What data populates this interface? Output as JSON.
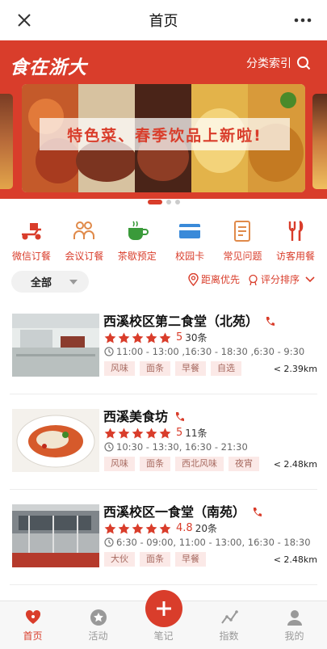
{
  "topbar": {
    "title": "首页"
  },
  "banner": {
    "logo_text": "食在浙大",
    "category_index_label": "分类索引",
    "slide_caption": "特色菜、春季饮品上新啦!",
    "slide_count": 3,
    "active_slide": 1
  },
  "quick_links": [
    {
      "label": "微信订餐",
      "icon": "delivery-scooter-icon"
    },
    {
      "label": "会议订餐",
      "icon": "group-people-icon"
    },
    {
      "label": "茶歇预定",
      "icon": "tea-cup-icon"
    },
    {
      "label": "校园卡",
      "icon": "campus-card-icon"
    },
    {
      "label": "常见问题",
      "icon": "faq-document-icon"
    },
    {
      "label": "访客用餐",
      "icon": "fork-knife-icon"
    }
  ],
  "filter": {
    "all_label": "全部",
    "distance_label": "距离优先",
    "rating_label": "评分排序"
  },
  "restaurants": [
    {
      "name": "西溪校区第二食堂（北苑）",
      "stars": 5,
      "score": "5",
      "count": "30条",
      "hours": "11:00 - 13:00 ,16:30 - 18:30 ,6:30 - 9:30",
      "tags": [
        "风味",
        "面条",
        "早餐",
        "自选"
      ],
      "distance": "< 2.39km"
    },
    {
      "name": "西溪美食坊",
      "stars": 5,
      "score": "5",
      "count": "11条",
      "hours": "10:30 - 13:30,  16:30 - 21:30",
      "tags": [
        "风味",
        "面条",
        "西北风味",
        "夜宵"
      ],
      "distance": "< 2.48km"
    },
    {
      "name": "西溪校区一食堂（南苑）",
      "stars": 5,
      "score": "4.8",
      "count": "20条",
      "hours": "6:30 - 09:00,  11:00 - 13:00,  16:30 - 18:30",
      "tags": [
        "大伙",
        "面条",
        "早餐"
      ],
      "distance": "< 2.48km"
    }
  ],
  "tabbar": {
    "items": [
      {
        "label": "首页",
        "icon": "home-heart-icon"
      },
      {
        "label": "活动",
        "icon": "star-circle-icon"
      },
      {
        "label": "笔记",
        "icon": "plus-icon"
      },
      {
        "label": "指数",
        "icon": "trend-line-icon"
      },
      {
        "label": "我的",
        "icon": "user-icon"
      }
    ],
    "active_index": 0
  },
  "colors": {
    "accent": "#d93d2b",
    "tag_bg": "#fbe9e7"
  }
}
